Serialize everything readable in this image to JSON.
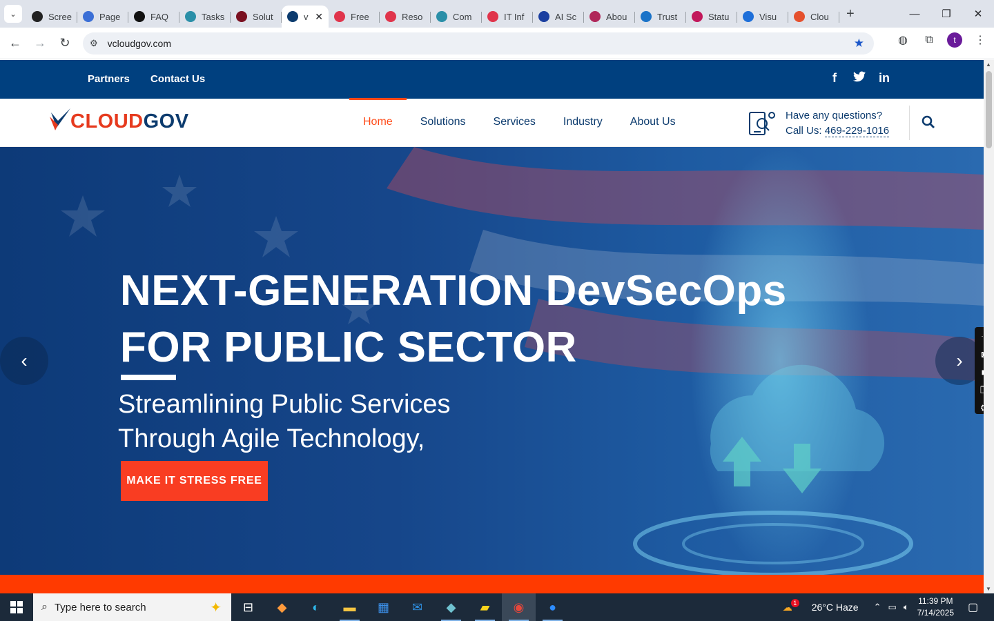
{
  "browser": {
    "tabs": [
      {
        "label": "Scree",
        "color": "#222"
      },
      {
        "label": "Page",
        "color": "#3b6fd6"
      },
      {
        "label": "FAQ",
        "color": "#111"
      },
      {
        "label": "Tasks",
        "color": "#2a8fa8"
      },
      {
        "label": "Solut",
        "color": "#7a1020"
      },
      {
        "label": "v",
        "color": "#0c3b6e",
        "active": true
      },
      {
        "label": "Free",
        "color": "#e0344b"
      },
      {
        "label": "Reso",
        "color": "#e0344b"
      },
      {
        "label": "Com",
        "color": "#2a8fa8"
      },
      {
        "label": "IT Inf",
        "color": "#e0344b"
      },
      {
        "label": "AI Sc",
        "color": "#1b3fa0"
      },
      {
        "label": "Abou",
        "color": "#b0285a"
      },
      {
        "label": "Trust",
        "color": "#1a73c8"
      },
      {
        "label": "Statu",
        "color": "#c2185b"
      },
      {
        "label": "Visu",
        "color": "#1e6fd9"
      },
      {
        "label": "Clou",
        "color": "#e5502d"
      }
    ],
    "url": "vcloudgov.com",
    "profile_initial": "t"
  },
  "site": {
    "topbar": {
      "partners": "Partners",
      "contact": "Contact Us"
    },
    "logo": {
      "part1": "CLOUD",
      "part2": "GOV"
    },
    "nav": [
      "Home",
      "Solutions",
      "Services",
      "Industry",
      "About Us"
    ],
    "contact": {
      "question": "Have any questions?",
      "call_label": "Call Us:",
      "phone": "469-229-1016"
    },
    "hero": {
      "title_line1": "NEXT-GENERATION DevSecOps",
      "title_line2": "FOR PUBLIC SECTOR",
      "sub_line1": "Streamlining Public Services",
      "sub_line2": "Through Agile Technology,",
      "cta": "MAKE IT STRESS FREE"
    }
  },
  "taskbar": {
    "search_placeholder": "Type here to search",
    "weather": "26°C  Haze",
    "weather_badge": "1",
    "time": "11:39 PM",
    "date": "7/14/2025"
  },
  "colors": {
    "brand_blue": "#00407f",
    "brand_orange": "#ff4a17",
    "cta": "#f93d22"
  }
}
